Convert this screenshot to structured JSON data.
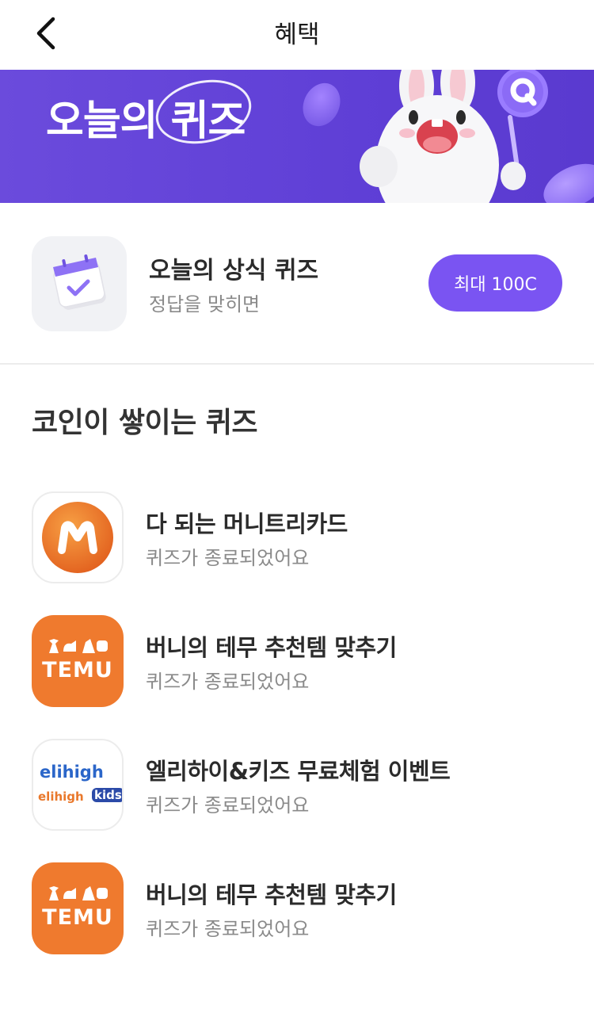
{
  "header": {
    "title": "혜택",
    "back_icon": "chevron-left-icon"
  },
  "banner": {
    "title": "오늘의 퀴즈",
    "mascot": "bunny-mascot",
    "accent": "#6b4bdc"
  },
  "quiz_card": {
    "title": "오늘의 상식 퀴즈",
    "subtitle": "정답을 맞히면",
    "reward_label": "최대 100C",
    "icon": "calendar-check-icon",
    "button_color": "#7a54f2"
  },
  "section": {
    "title": "코인이 쌓이는 퀴즈"
  },
  "items": [
    {
      "title": "다 되는 머니트리카드",
      "status": "퀴즈가 종료되었어요",
      "icon": "moneytree-logo-icon"
    },
    {
      "title": "버니의 테무 추천템 맞추기",
      "status": "퀴즈가 종료되었어요",
      "icon": "temu-logo-icon",
      "logo_text": "TEMU"
    },
    {
      "title": "엘리하이&키즈 무료체험 이벤트",
      "status": "퀴즈가 종료되었어요",
      "icon": "elihigh-logo-icon",
      "logo_text_top": "elihigh",
      "logo_text_bottom": "elihigh",
      "logo_text_kids": "kids"
    },
    {
      "title": "버니의 테무 추천템 맞추기",
      "status": "퀴즈가 종료되었어요",
      "icon": "temu-logo-icon",
      "logo_text": "TEMU"
    }
  ]
}
